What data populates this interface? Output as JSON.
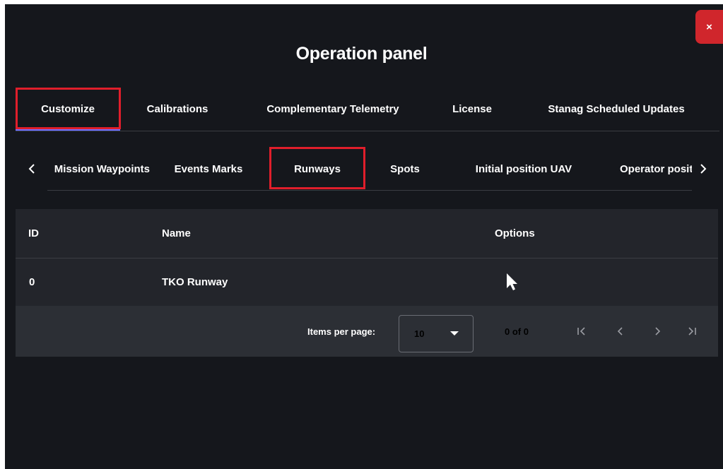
{
  "dialog": {
    "title": "Operation panel",
    "close_label": "×"
  },
  "main_tabs": [
    {
      "label": "Customize",
      "active": true
    },
    {
      "label": "Calibrations"
    },
    {
      "label": "Complementary Telemetry"
    },
    {
      "label": "License"
    },
    {
      "label": "Stanag Scheduled Updates"
    }
  ],
  "sub_tabs": [
    {
      "label": "Mission Waypoints"
    },
    {
      "label": "Events Marks"
    },
    {
      "label": "Runways",
      "active": true
    },
    {
      "label": "Spots"
    },
    {
      "label": "Initial position UAV"
    },
    {
      "label": "Operator position"
    }
  ],
  "table": {
    "columns": [
      "ID",
      "Name",
      "Options"
    ],
    "rows": [
      {
        "id": "0",
        "name": "TKO Runway"
      }
    ]
  },
  "paginator": {
    "items_per_page_label": "Items per page:",
    "page_size": "10",
    "range_label": "0 of 0",
    "first_icon": "|<",
    "prev_icon": "<",
    "next_icon": ">",
    "last_icon": ">|"
  },
  "colors": {
    "panel_bg": "#15171c",
    "table_bg": "#23252b",
    "pager_bg": "#2c2f35",
    "accent_underline": "#6f6fff",
    "highlight_box": "#e01e2b",
    "close_button": "#d0262c"
  }
}
